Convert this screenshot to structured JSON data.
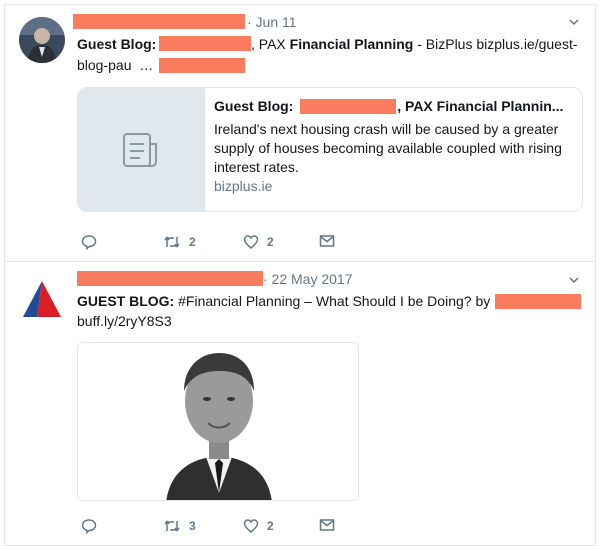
{
  "colors": {
    "redaction": "#f97c5f",
    "muted": "#657786",
    "border": "#e1e8ed"
  },
  "tweet1": {
    "time": "· Jun 11",
    "text_lead": "Guest Blog:",
    "text_mid1": ", PAX ",
    "text_bold": "Financial Planning",
    "text_after": " - BizPlus bizplus.ie/guest-",
    "text_line2": "blog-pau",
    "ellipsis": "…",
    "card": {
      "title_lead": "Guest Blog:",
      "title_tail": ", PAX Financial Plannin...",
      "description": "Ireland's next housing crash will be caused by a greater supply of houses becoming available coupled with rising interest rates.",
      "domain": "bizplus.ie",
      "thumb_icon": "document-icon"
    },
    "actions": {
      "retweets": "2",
      "likes": "2"
    }
  },
  "tweet2": {
    "time": "· 22 May 2017",
    "text_lead": "GUEST BLOG:",
    "hashtag": " #Financial Planning",
    "text_after": " – What Should I be Doing? by",
    "link": "buff.ly/2ryY8S3",
    "actions": {
      "retweets": "3",
      "likes": "2"
    }
  }
}
